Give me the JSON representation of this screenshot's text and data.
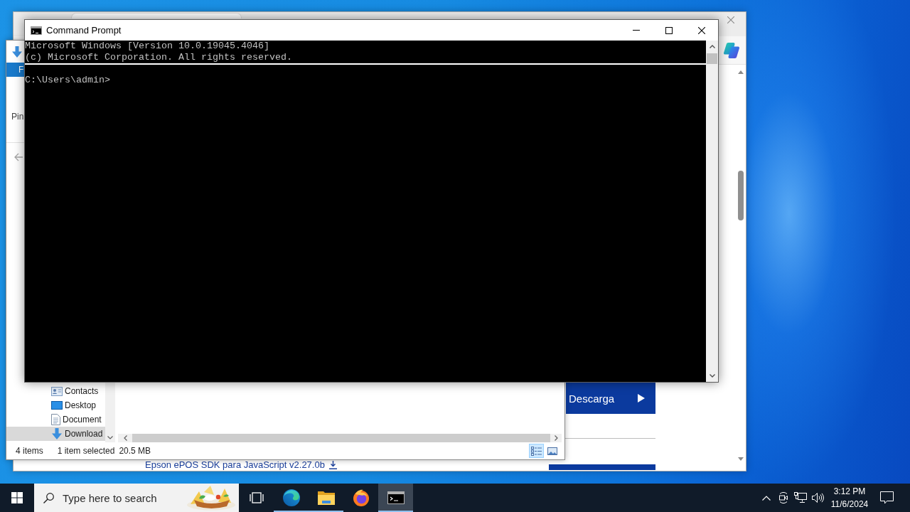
{
  "browser_window": {
    "page": {
      "download_button": {
        "label": "Descarga"
      },
      "link_text": "Epson ePOS SDK para JavaScript v2.27.0b"
    }
  },
  "file_explorer": {
    "ribbon_tab": "F",
    "ribbon_command": "Pin",
    "nav_items": [
      {
        "label": "Contacts",
        "kind": "contacts",
        "selected": false
      },
      {
        "label": "Desktop",
        "kind": "desktop",
        "selected": false
      },
      {
        "label": "Document",
        "kind": "documents",
        "selected": false
      },
      {
        "label": "Download",
        "kind": "downloads",
        "selected": true
      }
    ],
    "status_bar": {
      "item_count": "4 items",
      "selection": "1 item selected",
      "size": "20.5 MB"
    },
    "view_buttons": [
      {
        "kind": "details",
        "selected": true
      },
      {
        "kind": "large-icons",
        "selected": false
      }
    ]
  },
  "command_prompt": {
    "title": "Command Prompt",
    "output_lines": [
      "Microsoft Windows [Version 10.0.19045.4046]",
      "(c) Microsoft Corporation. All rights reserved."
    ],
    "prompt": "C:\\Users\\admin>"
  },
  "taskbar": {
    "search": {
      "placeholder": "Type here to search"
    },
    "apps": [
      {
        "kind": "edge",
        "running": true,
        "selected": false
      },
      {
        "kind": "explorer",
        "running": true,
        "selected": false
      },
      {
        "kind": "firefox",
        "running": false,
        "selected": false
      },
      {
        "kind": "cmd",
        "running": true,
        "selected": true
      }
    ],
    "clock": {
      "time": "3:12 PM",
      "date": "11/6/2024"
    }
  }
}
